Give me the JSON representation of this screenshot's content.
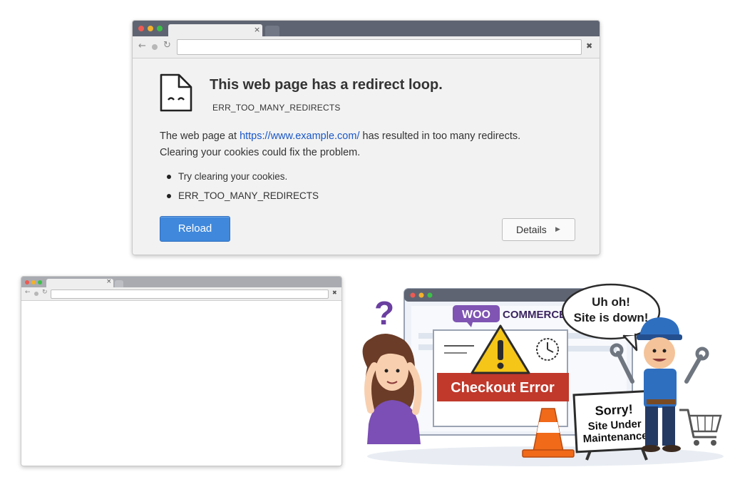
{
  "error_page": {
    "title": "This web page has a redirect loop.",
    "error_code": "ERR_TOO_MANY_REDIRECTS",
    "body_prefix": "The web page at ",
    "url": "https://www.example.com/",
    "body_suffix": " has resulted in too many redirects.",
    "body_line2": "Clearing your cookies could fix the problem.",
    "bullets": [
      "Try clearing your cookies.",
      "ERR_TOO_MANY_REDIRECTS"
    ],
    "reload_label": "Reload",
    "details_label": "Details",
    "tab_close_glyph": "×",
    "menu_glyph": "✖"
  },
  "blank_browser": {
    "tab_close_glyph": "×",
    "menu_glyph": "✖"
  },
  "illustration": {
    "brand_woo": "WOO",
    "brand_commerce": "COMMERCE",
    "banner_text": "Checkout Error",
    "speech_line1": "Uh oh!",
    "speech_line2": "Site is down!",
    "sign_line1": "Sorry!",
    "sign_line2": "Site Under",
    "sign_line3": "Maintenance",
    "question_mark": "?"
  },
  "icons": [
    "back-arrow-icon",
    "forward-icon",
    "refresh-icon",
    "sad-page-icon",
    "warning-icon",
    "clock-icon",
    "shopping-cart-icon",
    "traffic-cone-icon",
    "wrench-icon"
  ],
  "colors": {
    "reload_button": "#3f88dc",
    "link": "#1a57c8",
    "tab_bar": "#5f6472",
    "woo_purple": "#7f54b3",
    "error_red": "#c0392b",
    "warning_yellow": "#f5c518",
    "cone_orange": "#f06a1a"
  }
}
